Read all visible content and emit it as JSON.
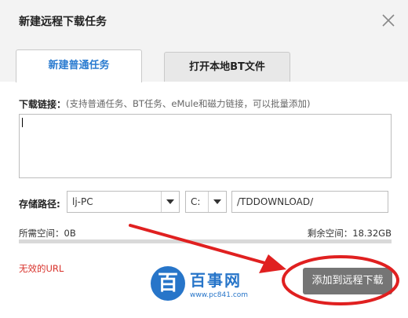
{
  "dialog": {
    "title": "新建远程下载任务",
    "close_icon": "close-icon"
  },
  "tabs": [
    {
      "label": "新建普通任务",
      "active": true
    },
    {
      "label": "打开本地BT文件",
      "active": false
    }
  ],
  "link": {
    "label": "下载链接：",
    "hint": "(支持普通任务、BT任务、eMule和磁力链接，可以批量添加)",
    "value": ""
  },
  "storage": {
    "label": "存储路径:",
    "device": "lj-PC",
    "drive": "C:",
    "path": "/TDDOWNLOAD/"
  },
  "space": {
    "required": "所需空间：0B",
    "remaining": "剩余空间：18.32GB",
    "used_fraction": 0
  },
  "error": "无效的URL",
  "actions": {
    "add_label": "添加到远程下载"
  },
  "watermark": {
    "glyph": "百",
    "name": "百事网",
    "url": "www.pc841.com"
  },
  "colors": {
    "accent": "#2a7bd0",
    "error": "#d8322b",
    "button": "#757575",
    "annotation": "#e02020"
  }
}
